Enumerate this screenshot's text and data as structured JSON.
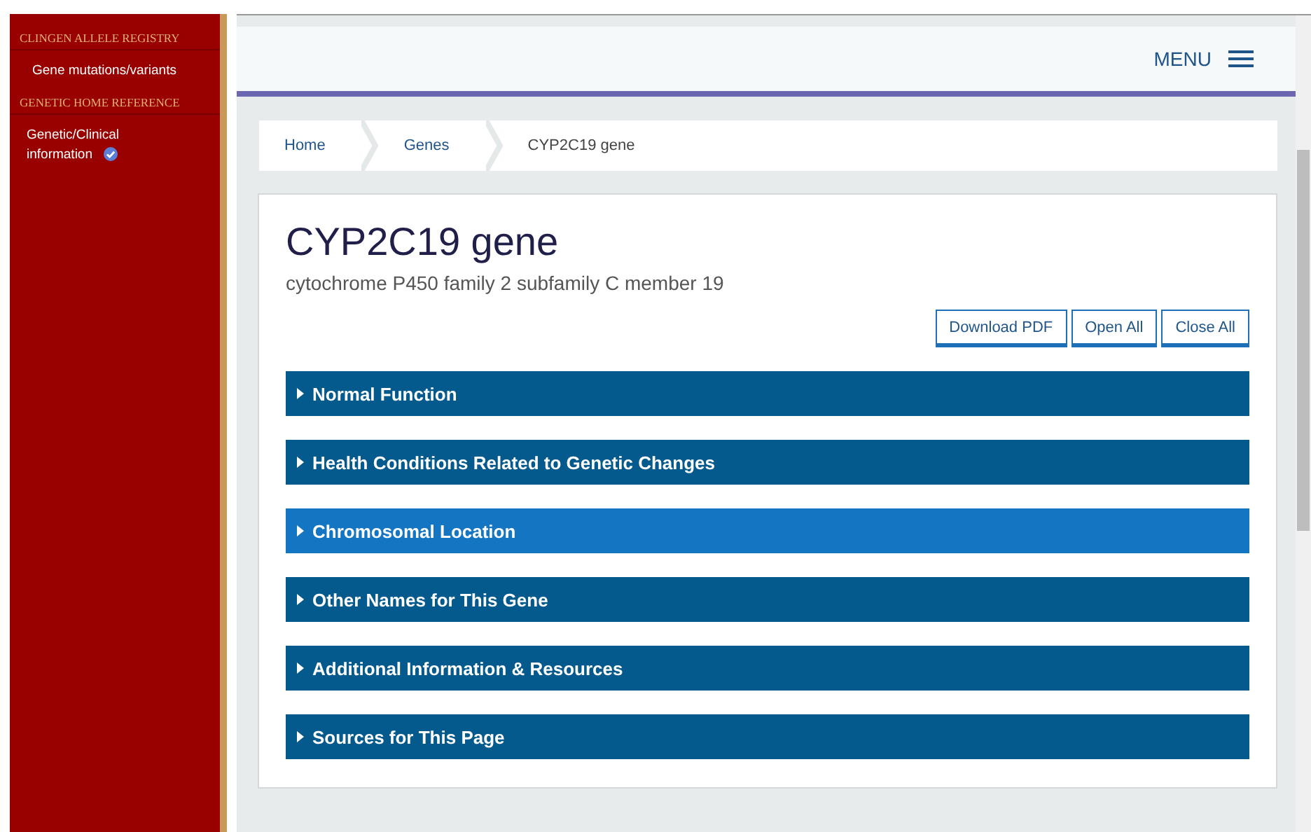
{
  "sidebar": {
    "groups": [
      {
        "heading": "CLINGEN ALLELE REGISTRY",
        "items": [
          {
            "label": "Gene mutations/variants",
            "verified": false
          }
        ]
      },
      {
        "heading": "GENETIC HOME REFERENCE",
        "items": [
          {
            "label": "Genetic/Clinical information",
            "verified": true
          }
        ]
      }
    ]
  },
  "header": {
    "menu_label": "MENU"
  },
  "breadcrumb": [
    {
      "label": "Home",
      "kind": "link"
    },
    {
      "label": "Genes",
      "kind": "link"
    },
    {
      "label": "CYP2C19 gene",
      "kind": "current"
    }
  ],
  "page": {
    "title": "CYP2C19 gene",
    "subtitle": "cytochrome P450 family 2 subfamily C member 19",
    "buttons": [
      "Download PDF",
      "Open All",
      "Close All"
    ],
    "sections": [
      {
        "label": "Normal Function",
        "highlighted": false
      },
      {
        "label": "Health Conditions Related to Genetic Changes",
        "highlighted": false
      },
      {
        "label": "Chromosomal Location",
        "highlighted": true
      },
      {
        "label": "Other Names for This Gene",
        "highlighted": false
      },
      {
        "label": "Additional Information & Resources",
        "highlighted": false
      },
      {
        "label": "Sources for This Page",
        "highlighted": false
      }
    ]
  }
}
